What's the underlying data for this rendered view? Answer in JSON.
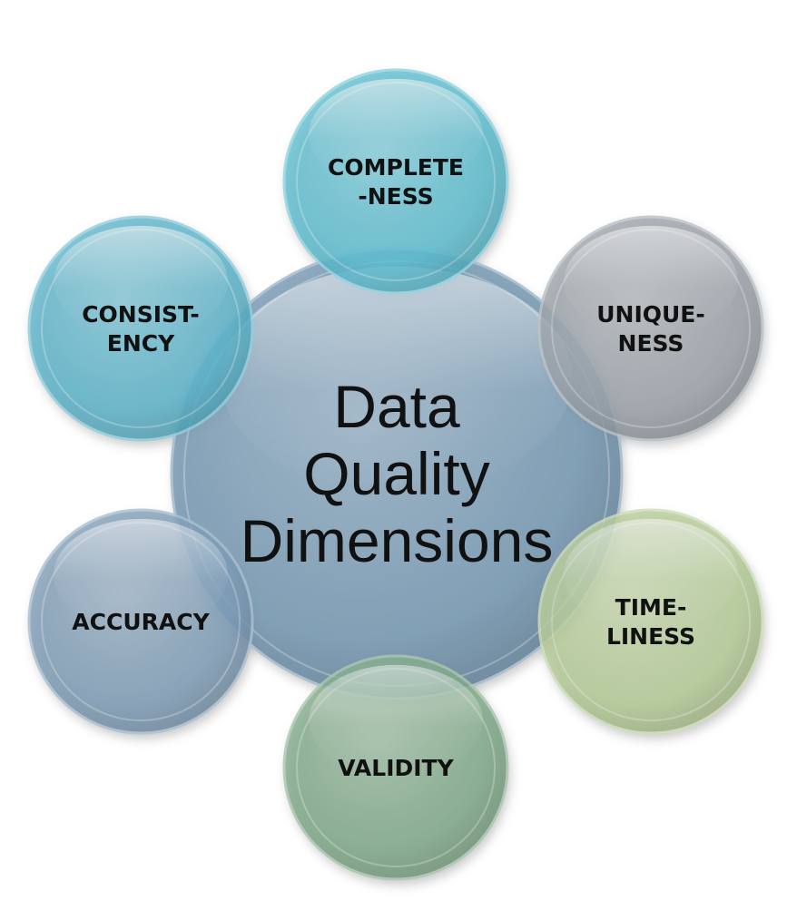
{
  "center": {
    "lines": [
      "Data",
      "Quality",
      "Dimensions"
    ],
    "color": "#7a9bb4"
  },
  "nodes": [
    {
      "id": "completeness",
      "lines": [
        "COMPLETE",
        "-NESS"
      ],
      "color": "#5bbdd0"
    },
    {
      "id": "uniqueness",
      "lines": [
        "UNIQUE-",
        "NESS"
      ],
      "color": "#9aa1a8"
    },
    {
      "id": "timeliness",
      "lines": [
        "TIME-",
        "LINESS"
      ],
      "color": "#b5cc96"
    },
    {
      "id": "validity",
      "lines": [
        "VALIDITY"
      ],
      "color": "#7fa987"
    },
    {
      "id": "accuracy",
      "lines": [
        "ACCURACY"
      ],
      "color": "#7d9cb6"
    },
    {
      "id": "consistency",
      "lines": [
        "CONSIST-",
        "ENCY"
      ],
      "color": "#5ab4cb"
    }
  ]
}
